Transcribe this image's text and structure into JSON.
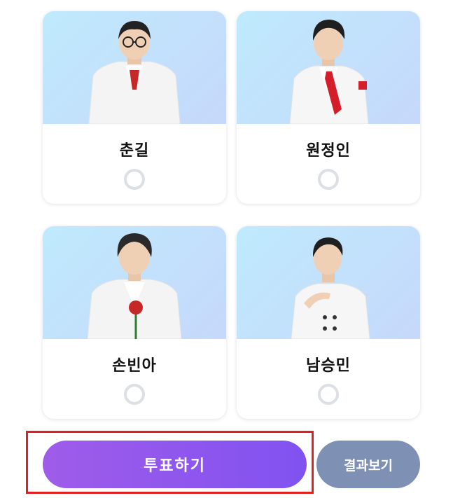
{
  "candidates": [
    {
      "name": "춘길",
      "selected": false
    },
    {
      "name": "원정인",
      "selected": false
    },
    {
      "name": "손빈아",
      "selected": false
    },
    {
      "name": "남승민",
      "selected": false
    }
  ],
  "actions": {
    "vote_label": "투표하기",
    "result_label": "결과보기"
  },
  "colors": {
    "vote_button_gradient_start": "#9f5ce9",
    "vote_button_gradient_end": "#8152f1",
    "result_button": "#7f90b5",
    "highlight": "#e02020",
    "photo_bg_start": "#bfeafd",
    "photo_bg_end": "#c6d8fb"
  }
}
